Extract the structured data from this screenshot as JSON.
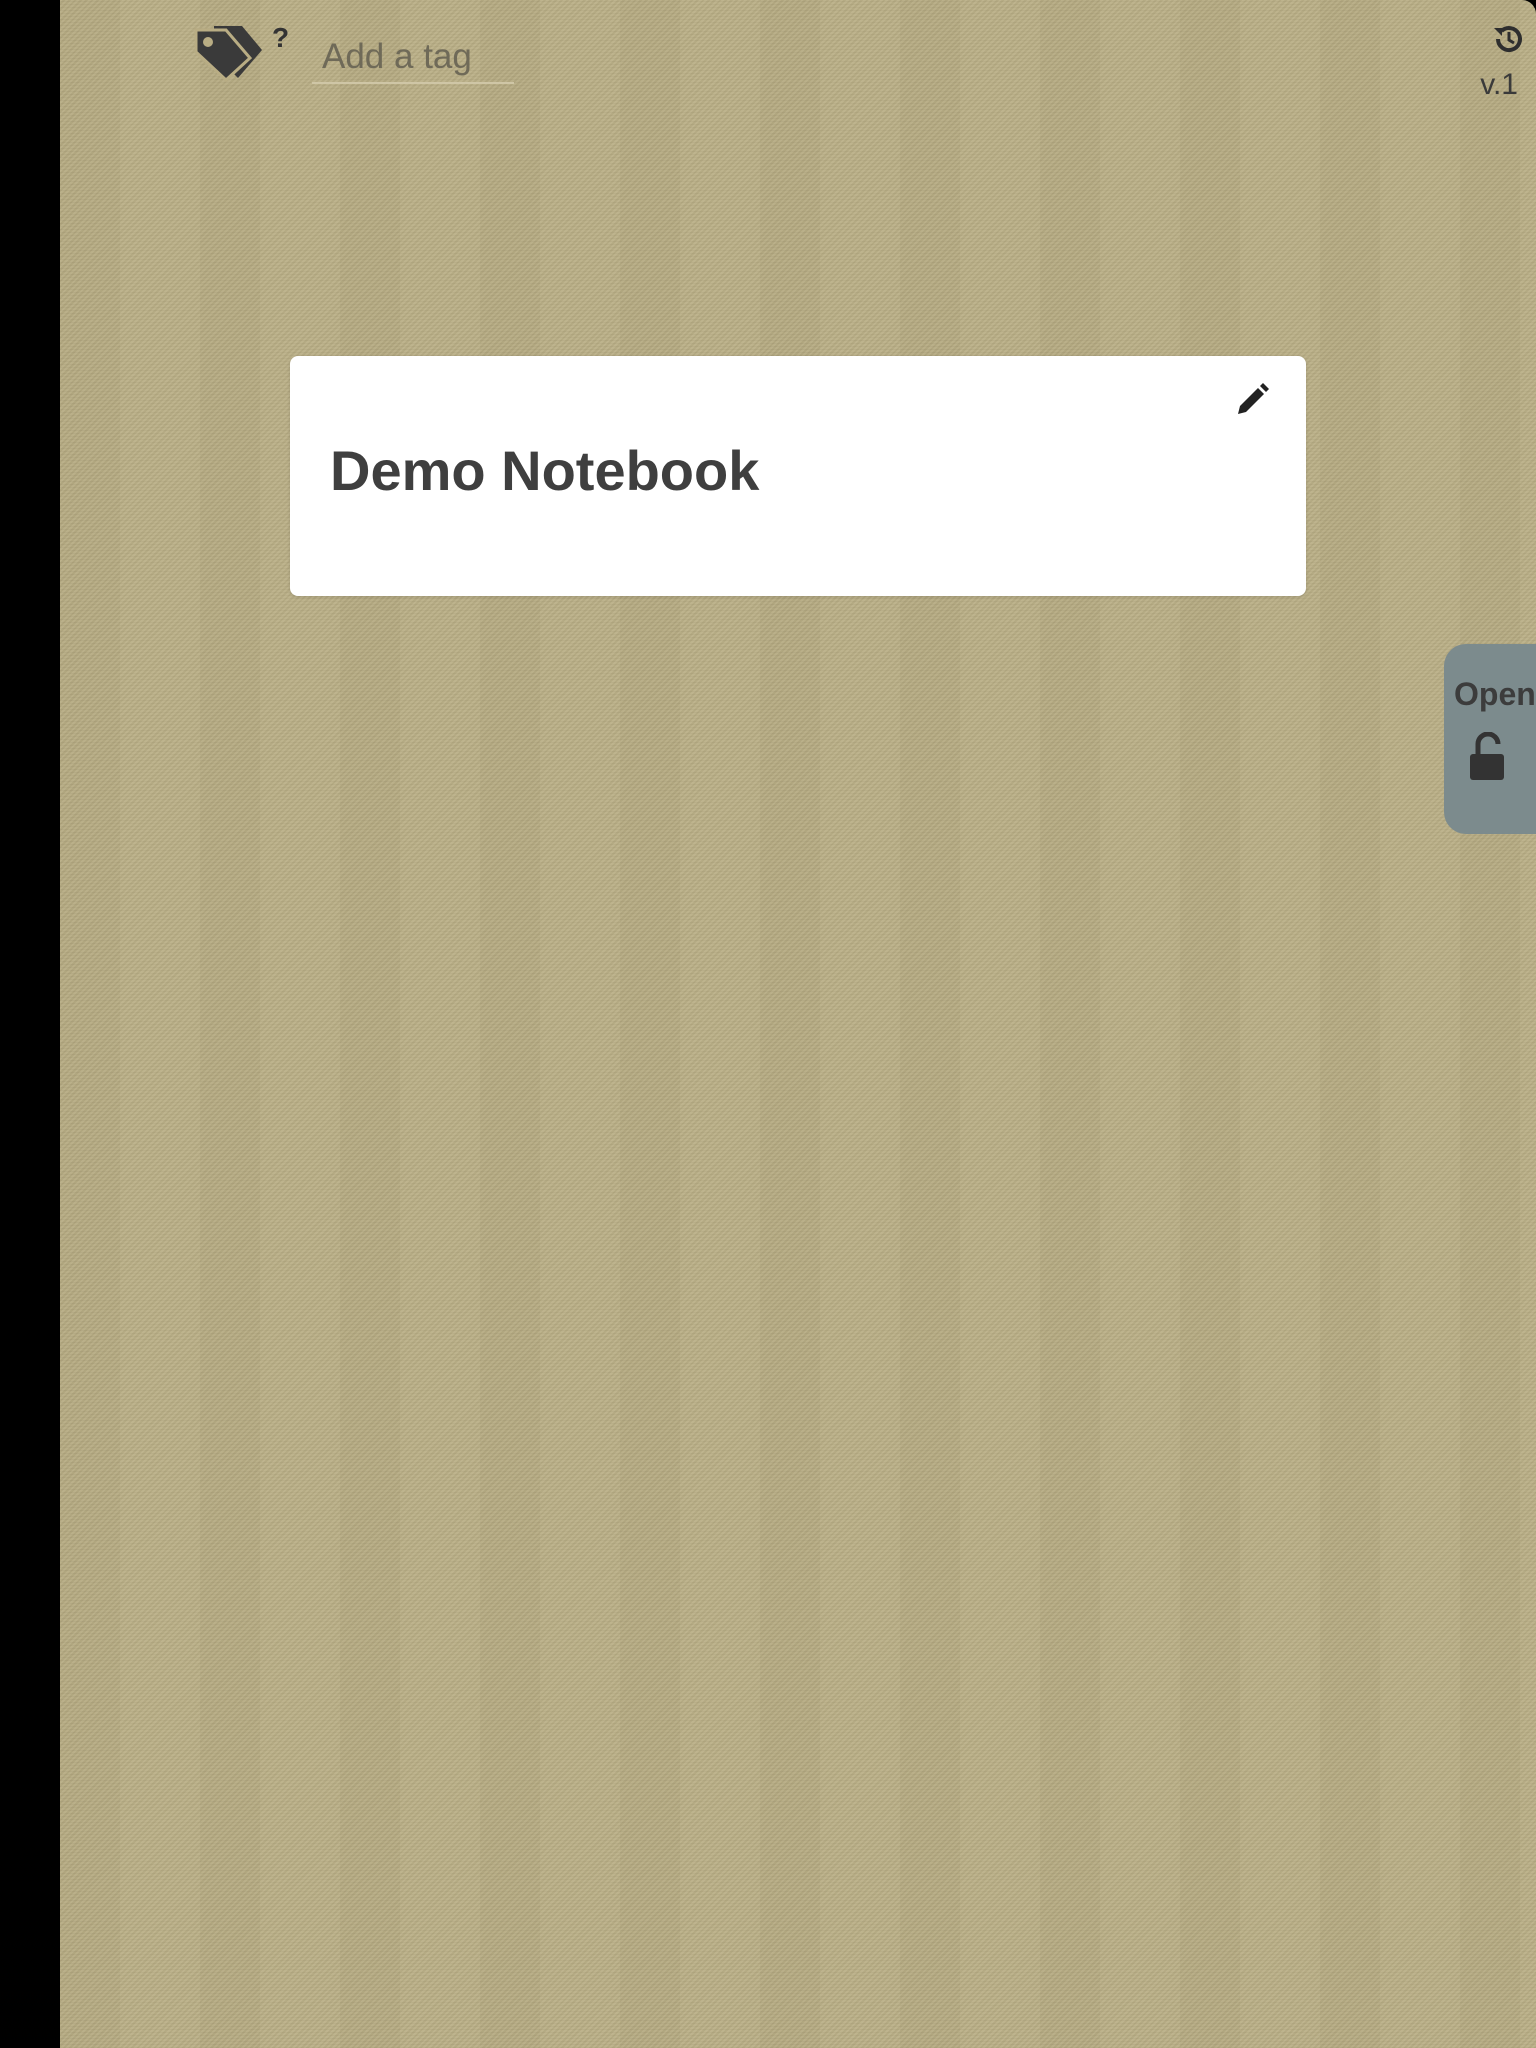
{
  "tags": {
    "icon": "tags-icon",
    "help_label": "?",
    "input_placeholder": "Add a tag",
    "input_value": ""
  },
  "header": {
    "history_icon": "history-icon",
    "version": "v.1"
  },
  "notebook": {
    "title": "Demo Notebook",
    "edit_icon": "pencil-icon"
  },
  "lock_tab": {
    "label": "Open",
    "icon": "unlock-icon",
    "color": "#7c8b8d"
  },
  "colors": {
    "background": "#b9ad84",
    "card": "#ffffff",
    "text": "#3f3f3f"
  }
}
